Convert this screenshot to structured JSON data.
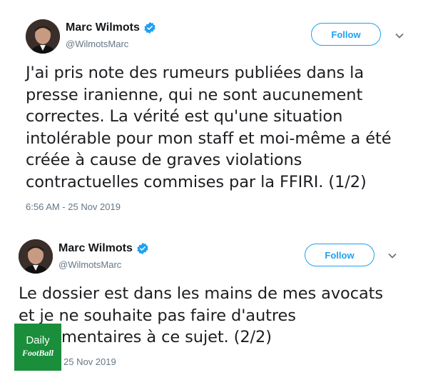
{
  "tweets": [
    {
      "name": "Marc Wilmots",
      "handle": "@WilmotsMarc",
      "follow_label": "Follow",
      "lines": [
        "J'ai pris note des rumeurs publiées dans la",
        "presse iranienne, qui ne sont aucunement",
        "correctes. La vérité est qu'une situation",
        "intolérable pour mon staff et moi-même a été",
        "créée à cause de graves violations",
        "contractuelles commises par la FFIRI. (1/2)"
      ],
      "timestamp": "6:56 AM - 25 Nov 2019"
    },
    {
      "name": "Marc Wilmots",
      "handle": "@WilmotsMarc",
      "follow_label": "Follow",
      "lines": [
        "Le dossier est dans les mains de mes avocats",
        "et je ne souhaite pas faire d'autres",
        "mentaires à ce sujet. (2/2)"
      ],
      "timestamp": "25 Nov 2019"
    }
  ],
  "watermark": {
    "line1": "Daily",
    "line2": "FootBall"
  },
  "colors": {
    "accent": "#1da1f2",
    "watermark_bg": "#1b8e3c",
    "muted": "#657786"
  }
}
